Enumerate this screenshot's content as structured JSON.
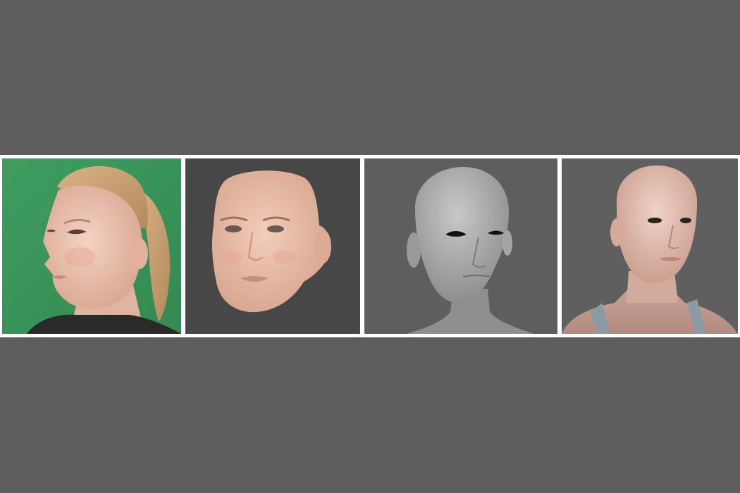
{
  "colors": {
    "page_background": "#5d5d5d",
    "frame": "#ffffff",
    "photo_backdrop": "#3f9a5e",
    "render_backdrop_dark": "#474747",
    "render_backdrop_mid": "#5e5e5e",
    "render_backdrop_light": "#5f5f5f"
  },
  "panels": [
    {
      "name": "photo",
      "content": "photo-of-woman-side-view"
    },
    {
      "name": "face-scan",
      "content": "textured-face-scan"
    },
    {
      "name": "base-mesh",
      "content": "grey-untextured-head-mesh"
    },
    {
      "name": "textured-avatar",
      "content": "textured-head-and-shoulders-render"
    }
  ]
}
